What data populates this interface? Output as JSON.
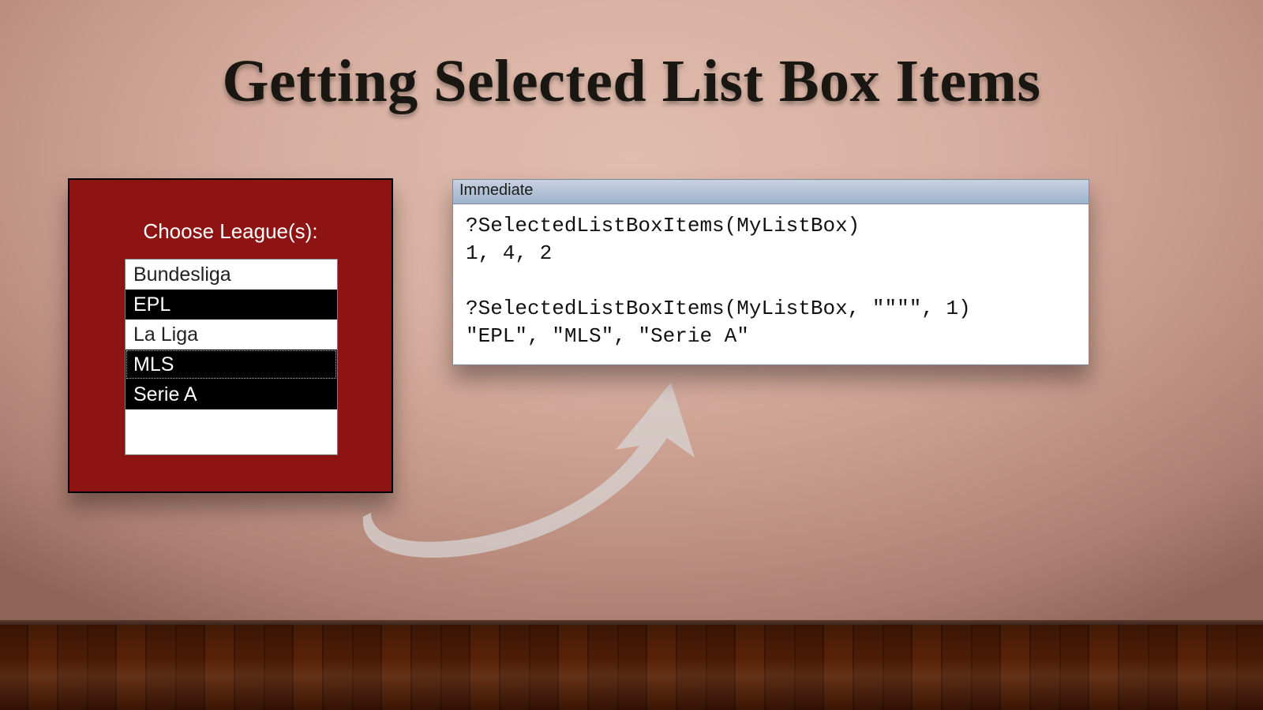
{
  "title": "Getting Selected List Box Items",
  "form": {
    "label": "Choose League(s):",
    "items": [
      {
        "text": "Bundesliga",
        "selected": false,
        "focused": false
      },
      {
        "text": "EPL",
        "selected": true,
        "focused": false
      },
      {
        "text": "La Liga",
        "selected": false,
        "focused": false
      },
      {
        "text": "MLS",
        "selected": true,
        "focused": true
      },
      {
        "text": "Serie A",
        "selected": true,
        "focused": false
      }
    ]
  },
  "immediate": {
    "title": "Immediate",
    "lines": [
      "?SelectedListBoxItems(MyListBox)",
      "1, 4, 2",
      "",
      "?SelectedListBoxItems(MyListBox, \"\"\"\", 1)",
      "\"EPL\", \"MLS\", \"Serie A\""
    ]
  }
}
